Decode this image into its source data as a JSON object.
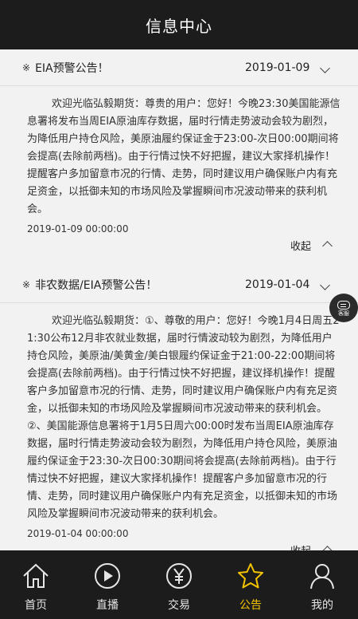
{
  "header": {
    "title": "信息中心"
  },
  "notices": [
    {
      "mark": "※",
      "title": "EIA预警公告！",
      "date": "2019-01-09",
      "body": "欢迎光临弘毅期货：尊贵的用户：您好！今晚23:30美国能源信息署将发布当周EIA原油库存数据，届时行情走势波动会较为剧烈，为降低用户持仓风险，美原油履约保证金于23:00-次日00:00期间将会提高(去除前两档)。由于行情过快不好把握，建议大家择机操作！提醒客户多加留意市况的行情、走势，同时建议用户确保账户内有充足资金，以抵御未知的市场风险及掌握瞬间市况波动带来的获利机会。",
      "timestamp": "2019-01-09 00:00:00",
      "collapse_label": "收起"
    },
    {
      "mark": "※",
      "title": "非农数据/EIA预警公告！",
      "date": "2019-01-04",
      "body": "欢迎光临弘毅期货：①、尊敬的用户：您好！今晚1月4日周五21:30公布12月非农就业数据，届时行情波动较为剧烈，为降低用户持仓风险，美原油/美黄金/美白银履约保证金于21:00-22:00期间将会提高(去除前两档)。由于行情过快不好把握，建议择机操作！提醒客户多加留意市况的行情、走势，同时建议用户确保账户内有充足资金，以抵御未知的市场风险及掌握瞬间市况波动带来的获利机会。②、美国能源信息署将于1月5日周六00:00时发布当周EIA原油库存数据，届时行情走势波动会较为剧烈，为降低用户持仓风险，美原油履约保证金于23:30-次日00:30期间将会提高(去除前两档)。由于行情过快不好把握，建议大家择机操作！提醒客户多加留意市况的行情、走势，同时建议用户确保账户内有充足资金，以抵御未知的市场风险及掌握瞬间市况波动带来的获利机会。",
      "timestamp": "2019-01-04 00:00:00",
      "collapse_label": "收起"
    }
  ],
  "float_button": {
    "label": "客服"
  },
  "tabs": [
    {
      "label": "首页",
      "icon": "home-icon"
    },
    {
      "label": "直播",
      "icon": "play-icon"
    },
    {
      "label": "交易",
      "icon": "yen-icon"
    },
    {
      "label": "公告",
      "icon": "star-icon"
    },
    {
      "label": "我的",
      "icon": "user-icon"
    }
  ],
  "active_tab": "公告",
  "colors": {
    "accent": "#f4c400",
    "bar": "#1c1c1c",
    "background": "#f2f2f2"
  }
}
